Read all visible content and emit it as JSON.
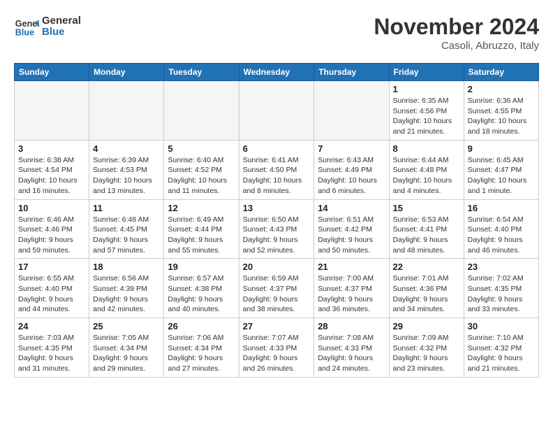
{
  "header": {
    "logo_line1": "General",
    "logo_line2": "Blue",
    "month": "November 2024",
    "location": "Casoli, Abruzzo, Italy"
  },
  "weekdays": [
    "Sunday",
    "Monday",
    "Tuesday",
    "Wednesday",
    "Thursday",
    "Friday",
    "Saturday"
  ],
  "weeks": [
    [
      {
        "day": "",
        "info": ""
      },
      {
        "day": "",
        "info": ""
      },
      {
        "day": "",
        "info": ""
      },
      {
        "day": "",
        "info": ""
      },
      {
        "day": "",
        "info": ""
      },
      {
        "day": "1",
        "info": "Sunrise: 6:35 AM\nSunset: 4:56 PM\nDaylight: 10 hours and 21 minutes."
      },
      {
        "day": "2",
        "info": "Sunrise: 6:36 AM\nSunset: 4:55 PM\nDaylight: 10 hours and 18 minutes."
      }
    ],
    [
      {
        "day": "3",
        "info": "Sunrise: 6:38 AM\nSunset: 4:54 PM\nDaylight: 10 hours and 16 minutes."
      },
      {
        "day": "4",
        "info": "Sunrise: 6:39 AM\nSunset: 4:53 PM\nDaylight: 10 hours and 13 minutes."
      },
      {
        "day": "5",
        "info": "Sunrise: 6:40 AM\nSunset: 4:52 PM\nDaylight: 10 hours and 11 minutes."
      },
      {
        "day": "6",
        "info": "Sunrise: 6:41 AM\nSunset: 4:50 PM\nDaylight: 10 hours and 8 minutes."
      },
      {
        "day": "7",
        "info": "Sunrise: 6:43 AM\nSunset: 4:49 PM\nDaylight: 10 hours and 6 minutes."
      },
      {
        "day": "8",
        "info": "Sunrise: 6:44 AM\nSunset: 4:48 PM\nDaylight: 10 hours and 4 minutes."
      },
      {
        "day": "9",
        "info": "Sunrise: 6:45 AM\nSunset: 4:47 PM\nDaylight: 10 hours and 1 minute."
      }
    ],
    [
      {
        "day": "10",
        "info": "Sunrise: 6:46 AM\nSunset: 4:46 PM\nDaylight: 9 hours and 59 minutes."
      },
      {
        "day": "11",
        "info": "Sunrise: 6:48 AM\nSunset: 4:45 PM\nDaylight: 9 hours and 57 minutes."
      },
      {
        "day": "12",
        "info": "Sunrise: 6:49 AM\nSunset: 4:44 PM\nDaylight: 9 hours and 55 minutes."
      },
      {
        "day": "13",
        "info": "Sunrise: 6:50 AM\nSunset: 4:43 PM\nDaylight: 9 hours and 52 minutes."
      },
      {
        "day": "14",
        "info": "Sunrise: 6:51 AM\nSunset: 4:42 PM\nDaylight: 9 hours and 50 minutes."
      },
      {
        "day": "15",
        "info": "Sunrise: 6:53 AM\nSunset: 4:41 PM\nDaylight: 9 hours and 48 minutes."
      },
      {
        "day": "16",
        "info": "Sunrise: 6:54 AM\nSunset: 4:40 PM\nDaylight: 9 hours and 46 minutes."
      }
    ],
    [
      {
        "day": "17",
        "info": "Sunrise: 6:55 AM\nSunset: 4:40 PM\nDaylight: 9 hours and 44 minutes."
      },
      {
        "day": "18",
        "info": "Sunrise: 6:56 AM\nSunset: 4:39 PM\nDaylight: 9 hours and 42 minutes."
      },
      {
        "day": "19",
        "info": "Sunrise: 6:57 AM\nSunset: 4:38 PM\nDaylight: 9 hours and 40 minutes."
      },
      {
        "day": "20",
        "info": "Sunrise: 6:59 AM\nSunset: 4:37 PM\nDaylight: 9 hours and 38 minutes."
      },
      {
        "day": "21",
        "info": "Sunrise: 7:00 AM\nSunset: 4:37 PM\nDaylight: 9 hours and 36 minutes."
      },
      {
        "day": "22",
        "info": "Sunrise: 7:01 AM\nSunset: 4:36 PM\nDaylight: 9 hours and 34 minutes."
      },
      {
        "day": "23",
        "info": "Sunrise: 7:02 AM\nSunset: 4:35 PM\nDaylight: 9 hours and 33 minutes."
      }
    ],
    [
      {
        "day": "24",
        "info": "Sunrise: 7:03 AM\nSunset: 4:35 PM\nDaylight: 9 hours and 31 minutes."
      },
      {
        "day": "25",
        "info": "Sunrise: 7:05 AM\nSunset: 4:34 PM\nDaylight: 9 hours and 29 minutes."
      },
      {
        "day": "26",
        "info": "Sunrise: 7:06 AM\nSunset: 4:34 PM\nDaylight: 9 hours and 27 minutes."
      },
      {
        "day": "27",
        "info": "Sunrise: 7:07 AM\nSunset: 4:33 PM\nDaylight: 9 hours and 26 minutes."
      },
      {
        "day": "28",
        "info": "Sunrise: 7:08 AM\nSunset: 4:33 PM\nDaylight: 9 hours and 24 minutes."
      },
      {
        "day": "29",
        "info": "Sunrise: 7:09 AM\nSunset: 4:32 PM\nDaylight: 9 hours and 23 minutes."
      },
      {
        "day": "30",
        "info": "Sunrise: 7:10 AM\nSunset: 4:32 PM\nDaylight: 9 hours and 21 minutes."
      }
    ]
  ]
}
